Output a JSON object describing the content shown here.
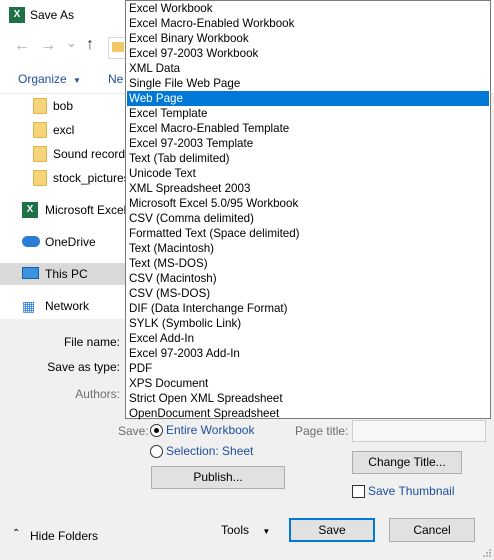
{
  "window": {
    "title": "Save As",
    "app_icon": "excel-icon"
  },
  "toolbar": {
    "organize_label": "Organize",
    "organize_arrow": "▼",
    "new_folder_label": "Ne"
  },
  "nav": {
    "back": "←",
    "forward": "→",
    "dropdown": "⌄",
    "up": "↑",
    "folders": [
      "bob",
      "excl",
      "Sound recordings",
      "stock_pictures"
    ],
    "roots": [
      "Microsoft Excel",
      "OneDrive",
      "This PC",
      "Network"
    ]
  },
  "fields": {
    "file_name_label": "File name:",
    "save_as_type_label": "Save as type:",
    "authors_label": "Authors:"
  },
  "dropdown": {
    "options": [
      "Excel Workbook",
      "Excel Macro-Enabled Workbook",
      "Excel Binary Workbook",
      "Excel 97-2003 Workbook",
      "XML Data",
      "Single File Web Page",
      "Web Page",
      "Excel Template",
      "Excel Macro-Enabled Template",
      "Excel 97-2003 Template",
      "Text (Tab delimited)",
      "Unicode Text",
      "XML Spreadsheet 2003",
      "Microsoft Excel 5.0/95 Workbook",
      "CSV (Comma delimited)",
      "Formatted Text (Space delimited)",
      "Text (Macintosh)",
      "Text (MS-DOS)",
      "CSV (Macintosh)",
      "CSV (MS-DOS)",
      "DIF (Data Interchange Format)",
      "SYLK (Symbolic Link)",
      "Excel Add-In",
      "Excel 97-2003 Add-In",
      "PDF",
      "XPS Document",
      "Strict Open XML Spreadsheet",
      "OpenDocument Spreadsheet"
    ],
    "selected": "Web Page"
  },
  "save_options": {
    "save_label": "Save:",
    "entire_workbook": "Entire Workbook",
    "selection_sheet": "Selection: Sheet",
    "page_title_label": "Page title:",
    "change_title": "Change Title...",
    "publish": "Publish...",
    "save_thumbnail": "Save Thumbnail"
  },
  "footer": {
    "hide_folders": "Hide Folders",
    "tools": "Tools",
    "save": "Save",
    "cancel": "Cancel"
  },
  "colors": {
    "selection": "#0078d7",
    "link": "#1f4e9b",
    "excel_green": "#1e7145"
  }
}
